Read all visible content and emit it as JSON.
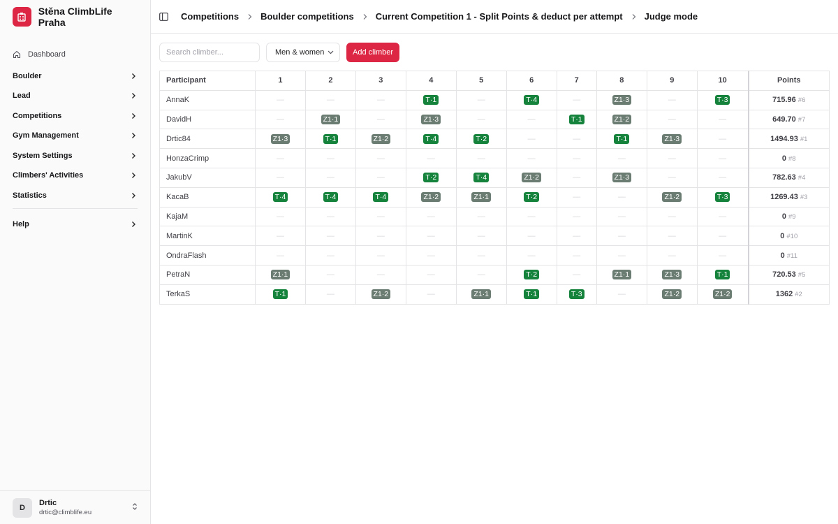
{
  "app": {
    "name": "Stěna ClimbLife Praha",
    "accent": "#dc2643"
  },
  "sidebar": {
    "dashboard": "Dashboard",
    "items": [
      "Boulder",
      "Lead",
      "Competitions",
      "Gym Management",
      "System Settings",
      "Climbers' Activities",
      "Statistics"
    ],
    "help": "Help"
  },
  "user": {
    "initial": "D",
    "name": "Drtic",
    "email": "drtic@climblife.eu"
  },
  "breadcrumb": [
    "Competitions",
    "Boulder competitions",
    "Current Competition 1 - Split Points & deduct per attempt",
    "Judge mode"
  ],
  "toolbar": {
    "search_placeholder": "Search climber...",
    "filter_value": "Men & women",
    "add_label": "Add climber"
  },
  "table": {
    "participant_header": "Participant",
    "points_header": "Points",
    "boulders": [
      "1",
      "2",
      "3",
      "4",
      "5",
      "6",
      "7",
      "8",
      "9",
      "10"
    ],
    "colors": {
      "top": "#16833d",
      "zone": "#6b7c72"
    },
    "rows": [
      {
        "name": "AnnaK",
        "results": [
          "",
          "",
          "",
          "T·1",
          "",
          "T·4",
          "",
          "Z1·3",
          "",
          "T·3"
        ],
        "points": "715.96",
        "rank": "#6"
      },
      {
        "name": "DavidH",
        "results": [
          "",
          "Z1·1",
          "",
          "Z1·3",
          "",
          "",
          "T·1",
          "Z1·2",
          "",
          ""
        ],
        "points": "649.70",
        "rank": "#7"
      },
      {
        "name": "Drtic84",
        "results": [
          "Z1·3",
          "T·1",
          "Z1·2",
          "T·4",
          "T·2",
          "",
          "",
          "T·1",
          "Z1·3",
          ""
        ],
        "points": "1494.93",
        "rank": "#1"
      },
      {
        "name": "HonzaCrimp",
        "results": [
          "",
          "",
          "",
          "",
          "",
          "",
          "",
          "",
          "",
          ""
        ],
        "points": "0",
        "rank": "#8"
      },
      {
        "name": "JakubV",
        "results": [
          "",
          "",
          "",
          "T·2",
          "T·4",
          "Z1·2",
          "",
          "Z1·3",
          "",
          ""
        ],
        "points": "782.63",
        "rank": "#4"
      },
      {
        "name": "KacaB",
        "results": [
          "T·4",
          "T·4",
          "T·4",
          "Z1·2",
          "Z1·1",
          "T·2",
          "",
          "",
          "Z1·2",
          "T·3"
        ],
        "points": "1269.43",
        "rank": "#3"
      },
      {
        "name": "KajaM",
        "results": [
          "",
          "",
          "",
          "",
          "",
          "",
          "",
          "",
          "",
          ""
        ],
        "points": "0",
        "rank": "#9"
      },
      {
        "name": "MartinK",
        "results": [
          "",
          "",
          "",
          "",
          "",
          "",
          "",
          "",
          "",
          ""
        ],
        "points": "0",
        "rank": "#10"
      },
      {
        "name": "OndraFlash",
        "results": [
          "",
          "",
          "",
          "",
          "",
          "",
          "",
          "",
          "",
          ""
        ],
        "points": "0",
        "rank": "#11"
      },
      {
        "name": "PetraN",
        "results": [
          "Z1·1",
          "",
          "",
          "",
          "",
          "T·2",
          "",
          "Z1·1",
          "Z1·3",
          "T·1"
        ],
        "points": "720.53",
        "rank": "#5"
      },
      {
        "name": "TerkaS",
        "results": [
          "T·1",
          "",
          "Z1·2",
          "",
          "Z1·1",
          "T·1",
          "T·3",
          "",
          "Z1·2",
          "Z1·2"
        ],
        "points": "1362",
        "rank": "#2"
      }
    ]
  }
}
